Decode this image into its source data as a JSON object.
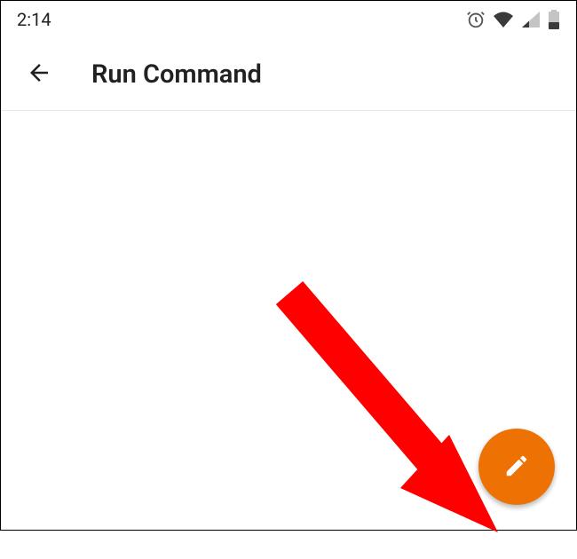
{
  "status_bar": {
    "time": "2:14"
  },
  "app_bar": {
    "title": "Run Command"
  },
  "colors": {
    "fab": "#ee7203",
    "annotation": "#ff0000"
  }
}
